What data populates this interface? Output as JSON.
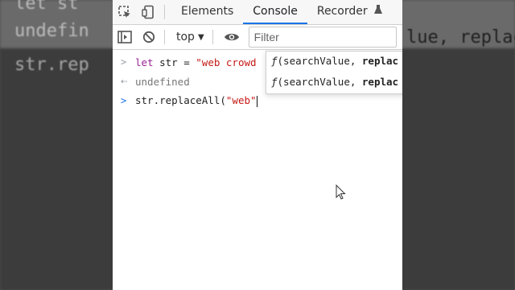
{
  "background": {
    "line1": "undefin",
    "line1b": "lue, replac",
    "line2": "str.rep",
    "top_fragment": "let st"
  },
  "tabbar": {
    "tabs": [
      {
        "label": "Elements"
      },
      {
        "label": "Console"
      },
      {
        "label": "Recorder"
      }
    ]
  },
  "toolbar": {
    "context": "top",
    "filter_placeholder": "Filter"
  },
  "console": {
    "line1": {
      "kw": "let",
      "rest": " str = ",
      "str": "\"web crowd"
    },
    "line2": "undefined",
    "line3": {
      "code": "str.replaceAll(",
      "str": "\"web\""
    }
  },
  "autocomplete": {
    "items": [
      {
        "fn": "ƒ",
        "sig": "(searchValue, ",
        "bold": "replac"
      },
      {
        "fn": "ƒ",
        "sig": "(searchValue, ",
        "bold": "replac"
      }
    ]
  },
  "colors": {
    "accent": "#1a73e8",
    "string": "#c41a16",
    "keyword": "#9b2393"
  }
}
